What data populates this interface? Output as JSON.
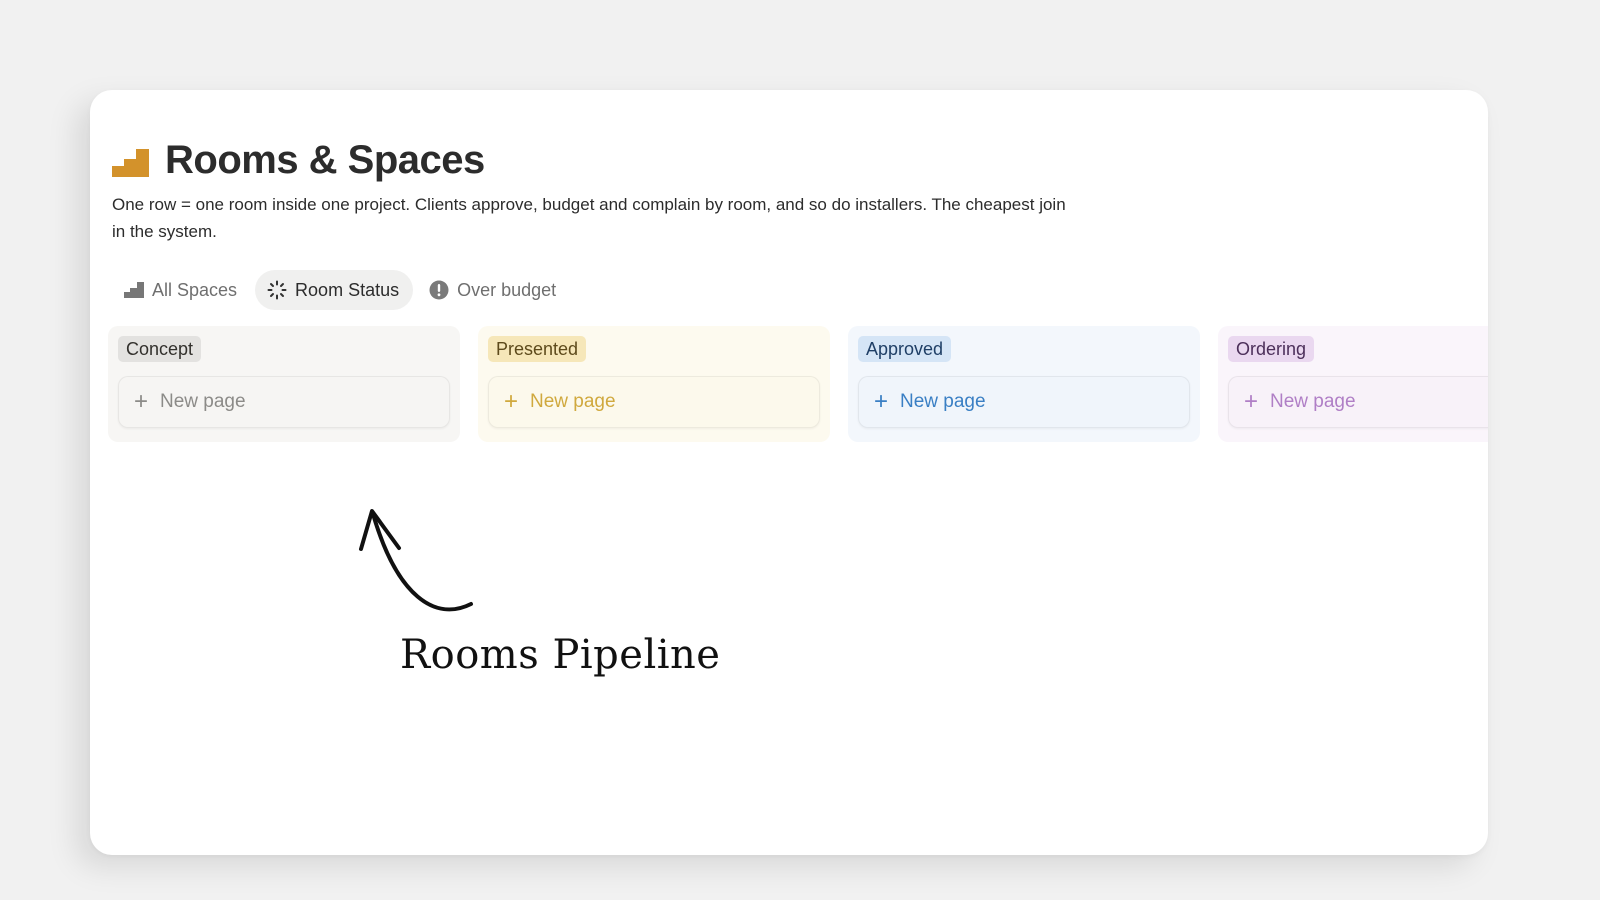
{
  "page": {
    "title": "Rooms & Spaces",
    "title_icon": "stairs-icon",
    "description": "One row = one room inside one project. Clients approve, budget and complain by room, and so do installers. The cheapest join in the system."
  },
  "tabs": [
    {
      "label": "All Spaces",
      "icon": "stairs-icon",
      "active": false
    },
    {
      "label": "Room Status",
      "icon": "loading-icon",
      "active": true
    },
    {
      "label": "Over budget",
      "icon": "alert-icon",
      "active": false
    }
  ],
  "columns": [
    {
      "label": "Concept",
      "new_page": "New page",
      "bg": "#f7f6f4",
      "badge_bg": "#e3e2e0",
      "badge_fg": "#32302c",
      "accent": "#8c8b88",
      "card_bg": "#f6f5f3"
    },
    {
      "label": "Presented",
      "new_page": "New page",
      "bg": "#fdfaef",
      "badge_bg": "#f6e7b9",
      "badge_fg": "#5d4a1b",
      "accent": "#d0a93e",
      "card_bg": "#fcf9ec"
    },
    {
      "label": "Approved",
      "new_page": "New page",
      "bg": "#f3f7fc",
      "badge_bg": "#d5e5f6",
      "badge_fg": "#1f3f66",
      "accent": "#3a7fc4",
      "card_bg": "#f0f5fb"
    },
    {
      "label": "Ordering",
      "new_page": "New page",
      "bg": "#faf5fb",
      "badge_bg": "#ead8f0",
      "badge_fg": "#4c2f5a",
      "accent": "#b07fc6",
      "card_bg": "#f8f2f9"
    }
  ],
  "annotation": {
    "text": "Rooms Pipeline"
  },
  "colors": {
    "title_icon": "#d3922b",
    "background": "#f1f1f1"
  }
}
